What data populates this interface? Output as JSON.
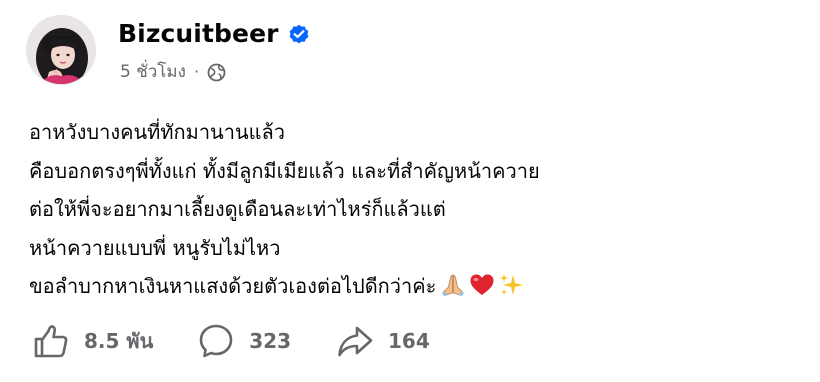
{
  "author": {
    "name": "Bizcuitbeer",
    "verified_icon": "verified-badge-icon",
    "avatar_icon": "profile-avatar"
  },
  "meta": {
    "timestamp": "5 ชั่วโมง",
    "separator": "·",
    "audience_icon": "globe-icon"
  },
  "post": {
    "lines": [
      "อาหวังบางคนที่ทักมานานแล้ว",
      "คือบอกตรงๆพี่ทั้งแก่ ทั้งมีลูกมีเมียแล้ว และที่สำคัญหน้าควาย",
      "ต่อให้พี่จะอยากมาเลี้ยงดูเดือนละเท่าไหร่ก็แล้วแต่",
      "หน้าควายแบบพี่ หนูรับไม่ไหว",
      "ขอลำบากหาเงินหาแสงด้วยตัวเองต่อไปดีกว่าค่ะ"
    ],
    "emojis": [
      "folded-hands",
      "red-heart",
      "sparkles"
    ]
  },
  "actions": {
    "like_count": "8.5 พัน",
    "comment_count": "323",
    "share_count": "164"
  },
  "colors": {
    "text": "#050505",
    "secondary": "#65676b",
    "verified": "#0866ff",
    "heart": "#e0242f"
  }
}
